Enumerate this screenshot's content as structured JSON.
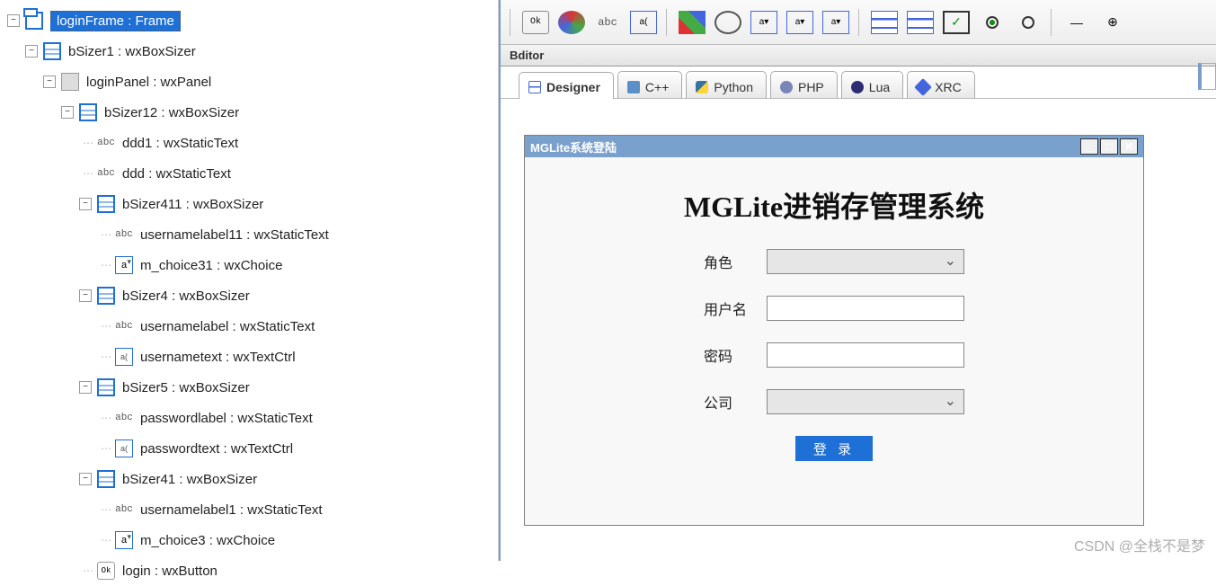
{
  "tree": {
    "n0": "loginFrame : Frame",
    "n1": "bSizer1 : wxBoxSizer",
    "n2": "loginPanel : wxPanel",
    "n3": "bSizer12 : wxBoxSizer",
    "n4": "ddd1 : wxStaticText",
    "n5": "ddd : wxStaticText",
    "n6": "bSizer411 : wxBoxSizer",
    "n7": "usernamelabel11 : wxStaticText",
    "n8": "m_choice31 : wxChoice",
    "n9": "bSizer4 : wxBoxSizer",
    "n10": "usernamelabel : wxStaticText",
    "n11": "usernametext : wxTextCtrl",
    "n12": "bSizer5 : wxBoxSizer",
    "n13": "passwordlabel : wxStaticText",
    "n14": "passwordtext : wxTextCtrl",
    "n15": "bSizer41 : wxBoxSizer",
    "n16": "usernamelabel1 : wxStaticText",
    "n17": "m_choice3 : wxChoice",
    "n18": "login : wxButton"
  },
  "toolbar_labels": {
    "ok": "Ok",
    "abc": "abc",
    "a_box": "a("
  },
  "editor_title": "Bditor",
  "tabs": {
    "designer": "Designer",
    "cpp": "C++",
    "python": "Python",
    "php": "PHP",
    "lua": "Lua",
    "xrc": "XRC"
  },
  "login_window": {
    "title": "MGLite系统登陆",
    "heading": "MGLite进销存管理系统",
    "role_label": "角色",
    "user_label": "用户名",
    "pass_label": "密码",
    "company_label": "公司",
    "login_button": "登 录"
  },
  "watermark": "CSDN @全栈不是梦"
}
